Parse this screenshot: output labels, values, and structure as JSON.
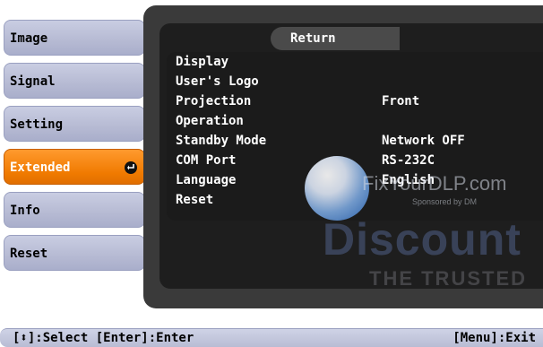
{
  "menu": {
    "items": [
      {
        "label": "Image"
      },
      {
        "label": "Signal"
      },
      {
        "label": "Setting"
      },
      {
        "label": "Extended"
      },
      {
        "label": "Info"
      },
      {
        "label": "Reset"
      }
    ],
    "active_index": 3,
    "accent_color": "#f07a00"
  },
  "panel": {
    "return_label": "Return",
    "rows": [
      {
        "label": "Display",
        "value": ""
      },
      {
        "label": "User's Logo",
        "value": ""
      },
      {
        "label": "Projection",
        "value": "Front"
      },
      {
        "label": "Operation",
        "value": ""
      },
      {
        "label": "Standby Mode",
        "value": "Network OFF"
      },
      {
        "label": "COM Port",
        "value": "RS-232C"
      },
      {
        "label": "Language",
        "value": "English"
      },
      {
        "label": "Reset",
        "value": ""
      }
    ]
  },
  "footer": {
    "left": "[⬍]:Select [Enter]:Enter",
    "right": "[Menu]:Exit"
  },
  "watermark": {
    "line1": "FixYourDLP.com",
    "line2": "Sponsored by DM",
    "line3": "Discount",
    "line4": "THE TRUSTED"
  }
}
